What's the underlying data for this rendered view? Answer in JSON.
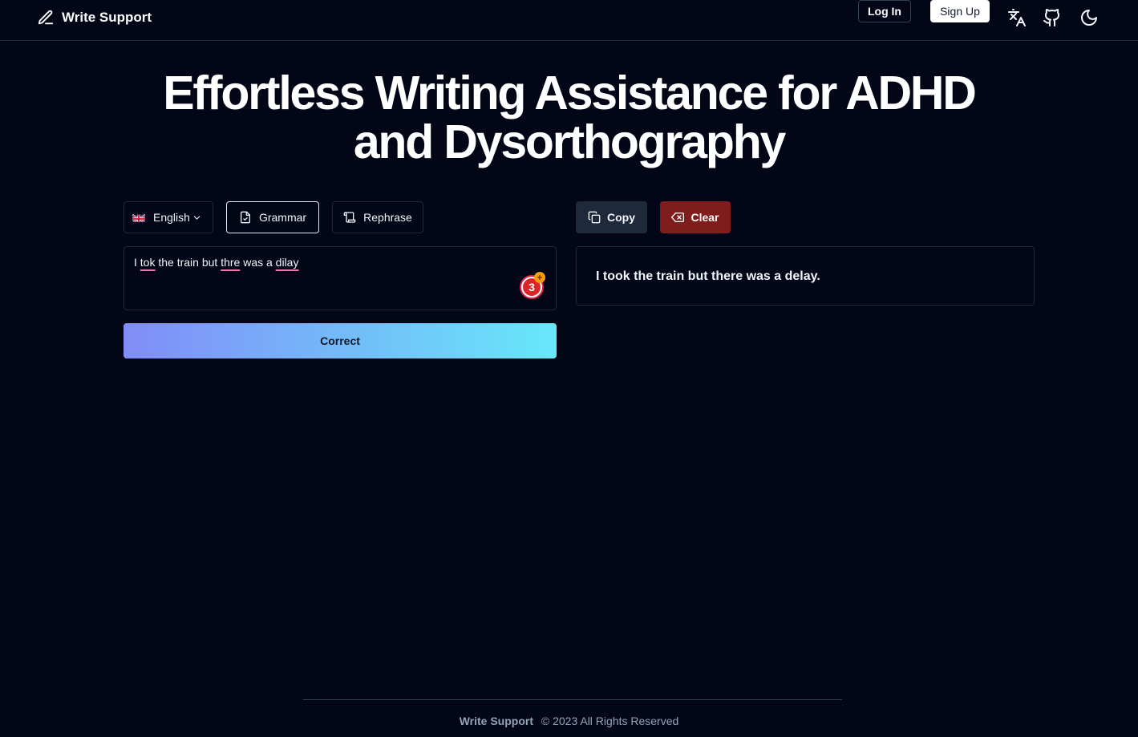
{
  "header": {
    "brand": "Write Support",
    "login_label": "Log In",
    "signup_label": "Sign Up",
    "icons": [
      "pencil-icon",
      "translate-icon",
      "github-icon",
      "moon-icon"
    ]
  },
  "hero": {
    "title_line1": "Effortless Writing Assistance for ADHD",
    "title_line2": "and Dysorthography"
  },
  "toolbar": {
    "language": "English",
    "grammar_label": "Grammar",
    "rephrase_label": "Rephrase",
    "copy_label": "Copy",
    "clear_label": "Clear"
  },
  "input": {
    "words": [
      "I ",
      "tok",
      " the train but ",
      "thre",
      " was a ",
      "dilay"
    ],
    "misspelled_indices": [
      1,
      3,
      5
    ],
    "error_count": "3",
    "badge_plus": "+"
  },
  "correct_label": "Correct",
  "output": {
    "text": "I took the train but there was a delay."
  },
  "footer": {
    "brand": "Write Support",
    "copyright": "© 2023 All Rights Reserved"
  },
  "colors": {
    "background": "#020617",
    "clear_button": "#7f1d1d",
    "gradient_start": "#818cf8",
    "gradient_end": "#67e8f9",
    "misspelling_underline": "#f472b6"
  }
}
